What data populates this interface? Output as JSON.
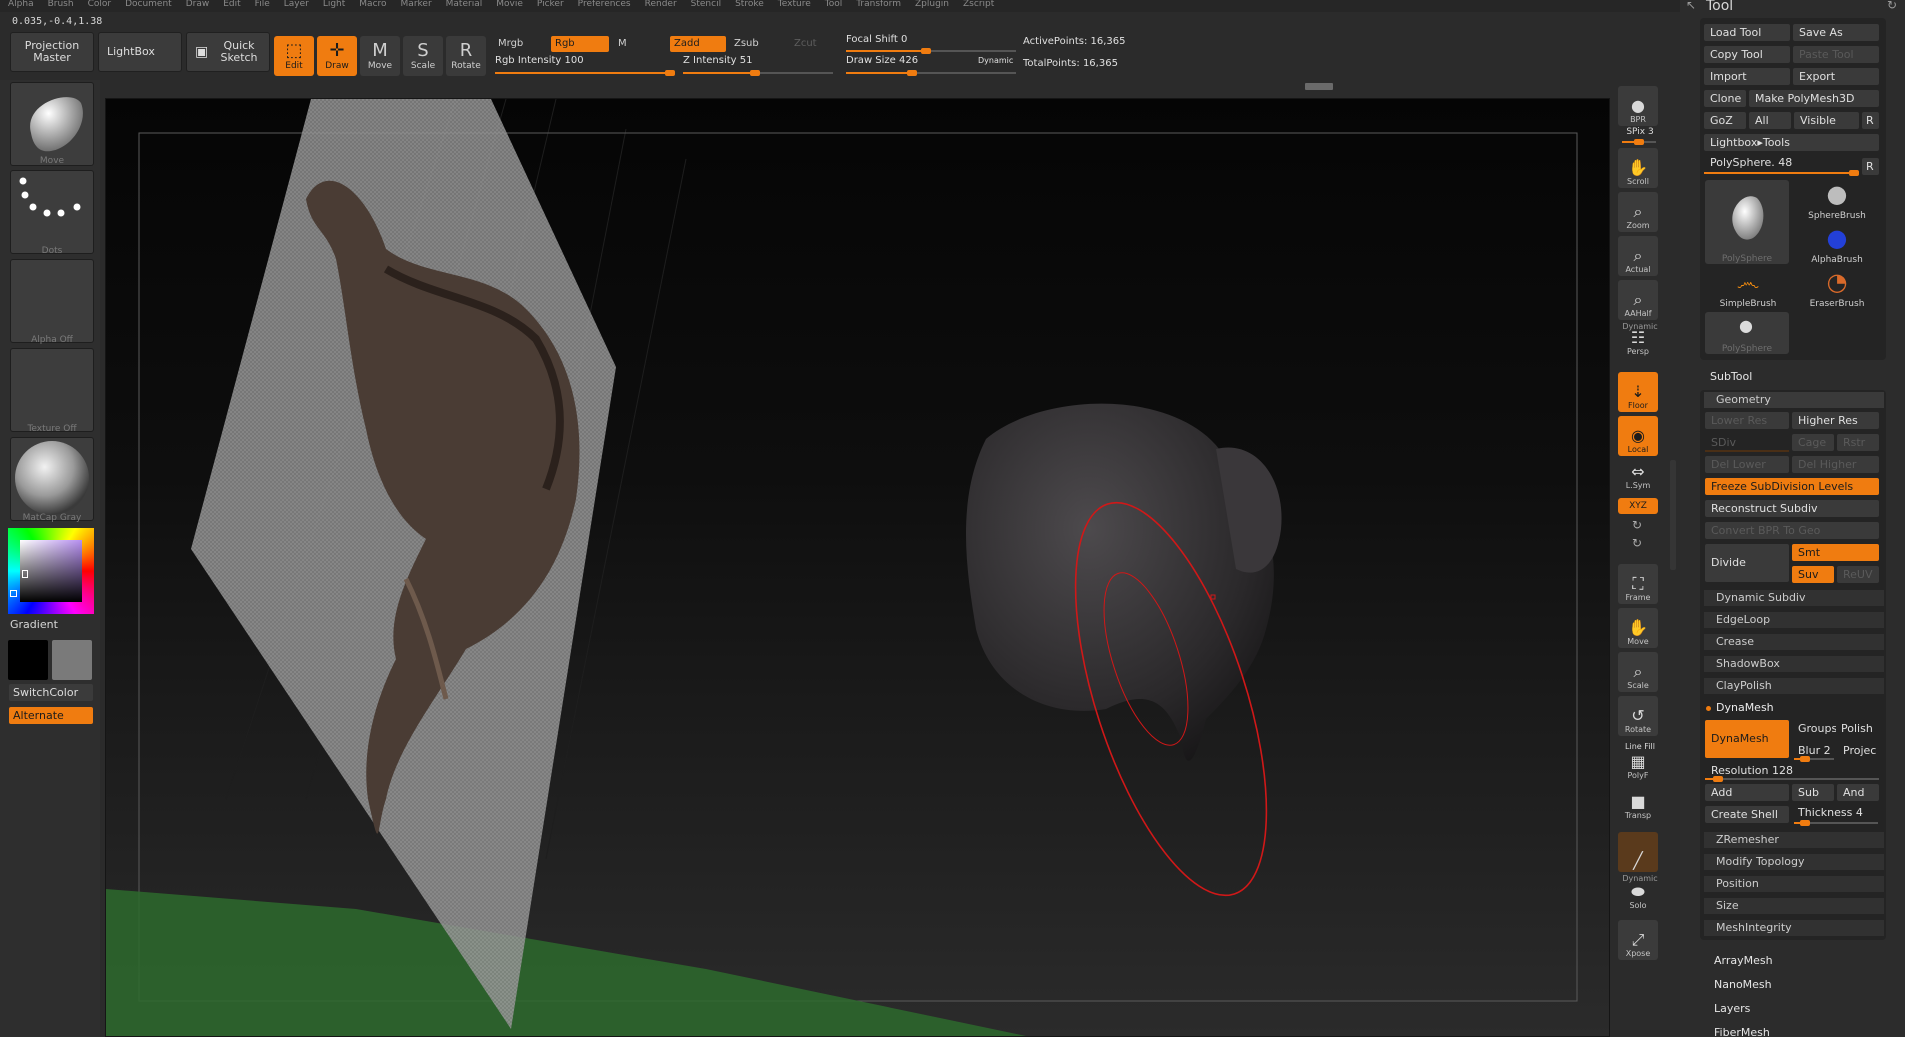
{
  "menu": [
    "Alpha",
    "Brush",
    "Color",
    "Document",
    "Draw",
    "Edit",
    "File",
    "Layer",
    "Light",
    "Macro",
    "Marker",
    "Material",
    "Movie",
    "Picker",
    "Preferences",
    "Render",
    "Stencil",
    "Stroke",
    "Texture",
    "Tool",
    "Transform",
    "Zplugin",
    "Zscript"
  ],
  "coords": "0.035,-0.4,1.38",
  "toolbar": {
    "projection_master": "Projection Master",
    "lightbox": "LightBox",
    "quick_sketch": "Quick Sketch",
    "edit": "Edit",
    "draw": "Draw",
    "move": "Move",
    "scale": "Scale",
    "rotate": "Rotate",
    "mrgb": "Mrgb",
    "rgb": "Rgb",
    "m": "M",
    "zadd": "Zadd",
    "zsub": "Zsub",
    "zcut": "Zcut",
    "rgb_intensity": "Rgb Intensity 100",
    "rgb_intensity_value": 1.0,
    "z_intensity": "Z Intensity 51",
    "z_intensity_value": 0.51,
    "focal_shift": "Focal Shift 0",
    "focal_shift_value": 0.5,
    "draw_size": "Draw Size 426",
    "draw_size_value": 0.42,
    "dynamic": "Dynamic",
    "active_points": "ActivePoints: 16,365",
    "total_points": "TotalPoints: 16,365"
  },
  "left": {
    "brush_label": "Move",
    "stroke_label": "Dots",
    "alpha_label": "Alpha Off",
    "texture_label": "Texture Off",
    "material_label": "MatCap Gray",
    "gradient": "Gradient",
    "switch_color": "SwitchColor",
    "alternate": "Alternate"
  },
  "right": {
    "bpr": "BPR",
    "spix": "SPix 3",
    "scroll": "Scroll",
    "zoom": "Zoom",
    "actual": "Actual",
    "aahalf": "AAHalf",
    "dynamic": "Dynamic",
    "persp": "Persp",
    "floor": "Floor",
    "local": "Local",
    "lsym": "L.Sym",
    "xyz": "XYZ",
    "frame": "Frame",
    "move": "Move",
    "scale": "Scale",
    "rotate": "Rotate",
    "line_fill": "Line Fill",
    "polyf": "PolyF",
    "transp": "Transp",
    "dynamic2": "Dynamic",
    "solo": "Solo",
    "xpose": "Xpose"
  },
  "tool": {
    "title": "Tool",
    "load_tool": "Load Tool",
    "save_as": "Save As",
    "copy_tool": "Copy Tool",
    "paste_tool": "Paste Tool",
    "import": "Import",
    "export": "Export",
    "clone": "Clone",
    "make_polymesh": "Make PolyMesh3D",
    "goz": "GoZ",
    "all": "All",
    "visible": "Visible",
    "r": "R",
    "lightbox_tools": "Lightbox▸Tools",
    "polysphere_slider": "PolySphere. 48",
    "thumbs": [
      "PolySphere",
      "SphereBrush",
      "AlphaBrush",
      "SimpleBrush",
      "EraserBrush",
      "PolySphere"
    ],
    "subtool": "SubTool",
    "geometry": "Geometry",
    "lower_res": "Lower Res",
    "higher_res": "Higher Res",
    "sdiv": "SDiv",
    "cage": "Cage",
    "rstr": "Rstr",
    "del_lower": "Del Lower",
    "del_higher": "Del Higher",
    "freeze": "Freeze SubDivision Levels",
    "reconstruct": "Reconstruct Subdiv",
    "convert_bpr": "Convert BPR To Geo",
    "divide": "Divide",
    "smt": "Smt",
    "suv": "Suv",
    "reuv": "ReUV",
    "dynamic_subdiv": "Dynamic Subdiv",
    "edgeloop": "EdgeLoop",
    "crease": "Crease",
    "shadowbox": "ShadowBox",
    "claypolish": "ClayPolish",
    "dynamesh_head": "DynaMesh",
    "dynamesh_btn": "DynaMesh",
    "groups": "Groups",
    "polish": "Polish",
    "blur": "Blur 2",
    "projec": "Projec",
    "resolution": "Resolution 128",
    "add": "Add",
    "sub": "Sub",
    "and": "And",
    "create_shell": "Create Shell",
    "thickness": "Thickness 4",
    "zremesher": "ZRemesher",
    "modify_topology": "Modify Topology",
    "position": "Position",
    "size": "Size",
    "meshintegrity": "MeshIntegrity",
    "arraymesh": "ArrayMesh",
    "nanomesh": "NanoMesh",
    "layers": "Layers",
    "fibermesh": "FiberMesh"
  }
}
